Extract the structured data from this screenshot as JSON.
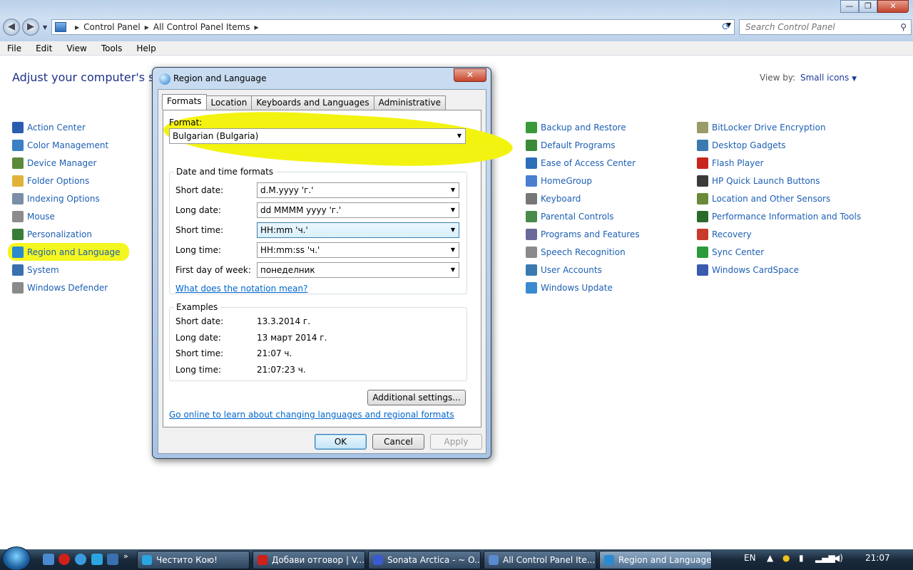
{
  "explorer": {
    "breadcrumb": [
      "Control Panel",
      "All Control Panel Items"
    ],
    "search_placeholder": "Search Control Panel",
    "window_buttons": {
      "minimize": "—",
      "maximize": "❐",
      "close": "✕"
    }
  },
  "menu": [
    "File",
    "Edit",
    "View",
    "Tools",
    "Help"
  ],
  "content": {
    "heading": "Adjust your computer's setti",
    "view_by_label": "View by:",
    "view_by_value": "Small icons",
    "columns": [
      [
        {
          "label": "Action Center",
          "icon": "flag-icon",
          "color": "#2a5db0"
        },
        {
          "label": "Color Management",
          "icon": "monitor-icon",
          "color": "#3b7fc4"
        },
        {
          "label": "Device Manager",
          "icon": "device-icon",
          "color": "#5b8a3a"
        },
        {
          "label": "Folder Options",
          "icon": "folder-icon",
          "color": "#e0b23a"
        },
        {
          "label": "Indexing Options",
          "icon": "indexing-icon",
          "color": "#7a8ea8"
        },
        {
          "label": "Mouse",
          "icon": "mouse-icon",
          "color": "#8c8c8c"
        },
        {
          "label": "Personalization",
          "icon": "personalization-icon",
          "color": "#3a7d3a"
        },
        {
          "label": "Region and Language",
          "icon": "globe-icon",
          "color": "#2a8ad0",
          "highlighted": true
        },
        {
          "label": "System",
          "icon": "system-icon",
          "color": "#3a6fb0"
        },
        {
          "label": "Windows Defender",
          "icon": "defender-icon",
          "color": "#8a8a8a"
        }
      ],
      [
        {
          "label": "Backup and Restore",
          "icon": "backup-icon",
          "color": "#3a9a3a"
        },
        {
          "label": "Default Programs",
          "icon": "default-programs-icon",
          "color": "#3a8a3a"
        },
        {
          "label": "Ease of Access Center",
          "icon": "ease-of-access-icon",
          "color": "#2a6fb8"
        },
        {
          "label": "HomeGroup",
          "icon": "homegroup-icon",
          "color": "#4a7fd0"
        },
        {
          "label": "Keyboard",
          "icon": "keyboard-icon",
          "color": "#777777"
        },
        {
          "label": "Parental Controls",
          "icon": "parental-icon",
          "color": "#4a8a4a"
        },
        {
          "label": "Programs and Features",
          "icon": "programs-icon",
          "color": "#6a6a9a"
        },
        {
          "label": "Speech Recognition",
          "icon": "microphone-icon",
          "color": "#8a8a8a"
        },
        {
          "label": "User Accounts",
          "icon": "user-accounts-icon",
          "color": "#3a7ab0"
        },
        {
          "label": "Windows Update",
          "icon": "windows-update-icon",
          "color": "#3a8ad0"
        }
      ],
      [
        {
          "label": "BitLocker Drive Encryption",
          "icon": "bitlocker-icon",
          "color": "#9a9a6a"
        },
        {
          "label": "Desktop Gadgets",
          "icon": "gadgets-icon",
          "color": "#3a7ab0"
        },
        {
          "label": "Flash Player",
          "icon": "flash-icon",
          "color": "#c8251c"
        },
        {
          "label": "HP Quick Launch Buttons",
          "icon": "hp-icon",
          "color": "#3a3a3a"
        },
        {
          "label": "Location and Other Sensors",
          "icon": "sensors-icon",
          "color": "#6a8a3a"
        },
        {
          "label": "Performance Information and Tools",
          "icon": "performance-icon",
          "color": "#2a6a2a"
        },
        {
          "label": "Recovery",
          "icon": "recovery-icon",
          "color": "#c83a2a"
        },
        {
          "label": "Sync Center",
          "icon": "sync-icon",
          "color": "#2a9a3a"
        },
        {
          "label": "Windows CardSpace",
          "icon": "cardspace-icon",
          "color": "#3a5ab0"
        }
      ]
    ]
  },
  "dialog": {
    "title": "Region and Language",
    "close": "✕",
    "tabs": [
      "Formats",
      "Location",
      "Keyboards and Languages",
      "Administrative"
    ],
    "format_label": "Format:",
    "format_value": "Bulgarian (Bulgaria)",
    "datetime_group": "Date and time formats",
    "fields": [
      {
        "label": "Short date:",
        "value": "d.M.yyyy 'г.'"
      },
      {
        "label": "Long date:",
        "value": "dd MMMM yyyy 'г.'"
      },
      {
        "label": "Short time:",
        "value": "HH:mm 'ч.'",
        "selected": true
      },
      {
        "label": "Long time:",
        "value": "HH:mm:ss 'ч.'"
      },
      {
        "label": "First day of week:",
        "value": "понеделник"
      }
    ],
    "notation_link": "What does the notation mean?",
    "examples_group": "Examples",
    "examples": [
      {
        "label": "Short date:",
        "value": "13.3.2014 г."
      },
      {
        "label": "Long date:",
        "value": "13 март 2014 г."
      },
      {
        "label": "Short time:",
        "value": "21:07 ч."
      },
      {
        "label": "Long time:",
        "value": "21:07:23 ч."
      }
    ],
    "additional_settings": "Additional settings...",
    "online_link": "Go online to learn about changing languages and regional formats",
    "ok": "OK",
    "cancel": "Cancel",
    "apply": "Apply",
    "highlight_color": "#f3f312"
  },
  "taskbar": {
    "more": "»",
    "tasks": [
      {
        "label": "Честито Кою!",
        "color": "#2aa5e0"
      },
      {
        "label": "Добави отговор | V...",
        "color": "#d0201a"
      },
      {
        "label": "Sonata Arctica - ~ O...",
        "color": "#3a5ad0"
      },
      {
        "label": "All Control Panel Ite...",
        "color": "#5a8ad0"
      },
      {
        "label": "Region and Language",
        "color": "#2a8ad0",
        "active": true
      }
    ],
    "lang": "EN",
    "clock": "21:07"
  }
}
